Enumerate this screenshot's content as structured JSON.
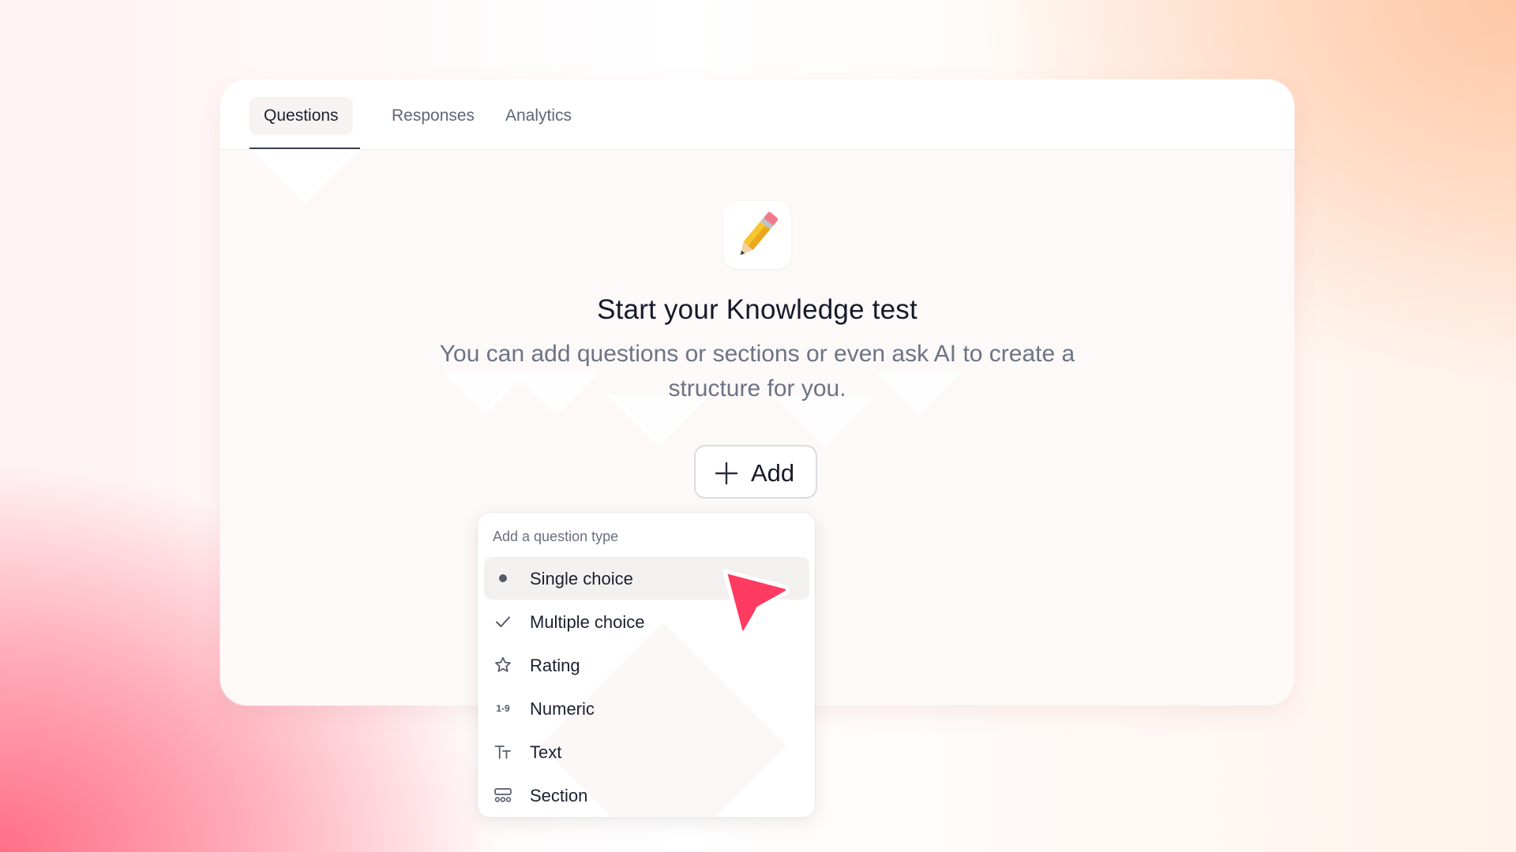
{
  "tabs": [
    {
      "label": "Questions",
      "active": true
    },
    {
      "label": "Responses",
      "active": false
    },
    {
      "label": "Analytics",
      "active": false
    }
  ],
  "empty_state": {
    "icon": "pencil-emoji",
    "title": "Start your Knowledge test",
    "subtitle": "You can add questions or sections or even ask AI to create a structure for you."
  },
  "add_button": {
    "label": "Add",
    "icon": "plus-icon"
  },
  "question_menu": {
    "header": "Add a question type",
    "items": [
      {
        "label": "Single choice",
        "icon": "dot-icon",
        "highlighted": true
      },
      {
        "label": "Multiple choice",
        "icon": "check-icon"
      },
      {
        "label": "Rating",
        "icon": "star-icon"
      },
      {
        "label": "Numeric",
        "icon": "numeric-icon",
        "icon_text": "1-9"
      },
      {
        "label": "Text",
        "icon": "text-icon"
      },
      {
        "label": "Section",
        "icon": "section-icon"
      }
    ]
  },
  "colors": {
    "accent_cursor": "#ff3b62",
    "text_primary": "#151a2b",
    "text_muted": "#6c7385"
  }
}
